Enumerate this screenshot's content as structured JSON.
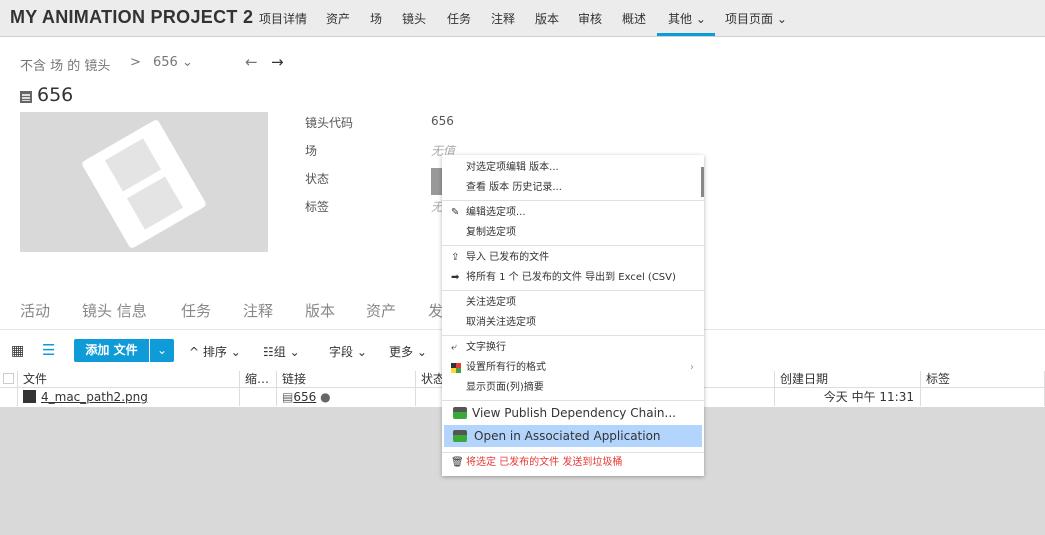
{
  "topnav": {
    "brand": "MY ANIMATION PROJECT 2",
    "items": [
      "项目详情",
      "资产",
      "场",
      "镜头",
      "任务",
      "注释",
      "版本",
      "审核",
      "概述",
      "其他 ⌄",
      "项目页面 ⌄"
    ],
    "active_index": 9,
    "accent": "#0f9ad8"
  },
  "breadcrumb": {
    "parent": "不含 场 的 镜头",
    "sep": ">",
    "current": "656 ⌄",
    "prev": "←",
    "next": "→"
  },
  "entity": {
    "title": "656",
    "icon": "film-icon"
  },
  "fields": [
    {
      "label": "镜头代码",
      "value": "656"
    },
    {
      "label": "场",
      "value": "无值"
    },
    {
      "label": "状态",
      "value": ""
    },
    {
      "label": "标签",
      "value": "无"
    }
  ],
  "tabs": [
    "活动",
    "镜头 信息",
    "任务",
    "注释",
    "版本",
    "资产",
    "发"
  ],
  "toolbar": {
    "add_label": "添加 文件",
    "sort": "排序 ⌄",
    "group": "组 ⌄",
    "fields": "字段 ⌄",
    "more": "更多 ⌄"
  },
  "table": {
    "headers": [
      "文件",
      "缩…",
      "链接",
      "状态",
      "创建日期",
      "标签"
    ],
    "rows": [
      {
        "file": "4_mac_path2.png",
        "link": "656",
        "created": "今天 中午 11:31"
      }
    ]
  },
  "menu": {
    "items": [
      "对选定项编辑 版本...",
      "查看 版本 历史记录...",
      "编辑选定项...",
      "复制选定项",
      "导入 已发布的文件",
      "将所有 1 个 已发布的文件 导出到 Excel (CSV)",
      "关注选定项",
      "取消关注选定项",
      "文字换行",
      "设置所有行的格式",
      "显示页面(列)摘要",
      "View Publish Dependency Chain...",
      "Open in Associated Application",
      "将选定 已发布的文件 发送到垃圾桶"
    ],
    "highlighted_index": 12,
    "danger_color": "#e53935",
    "highlight_color": "#b3d4fc"
  }
}
